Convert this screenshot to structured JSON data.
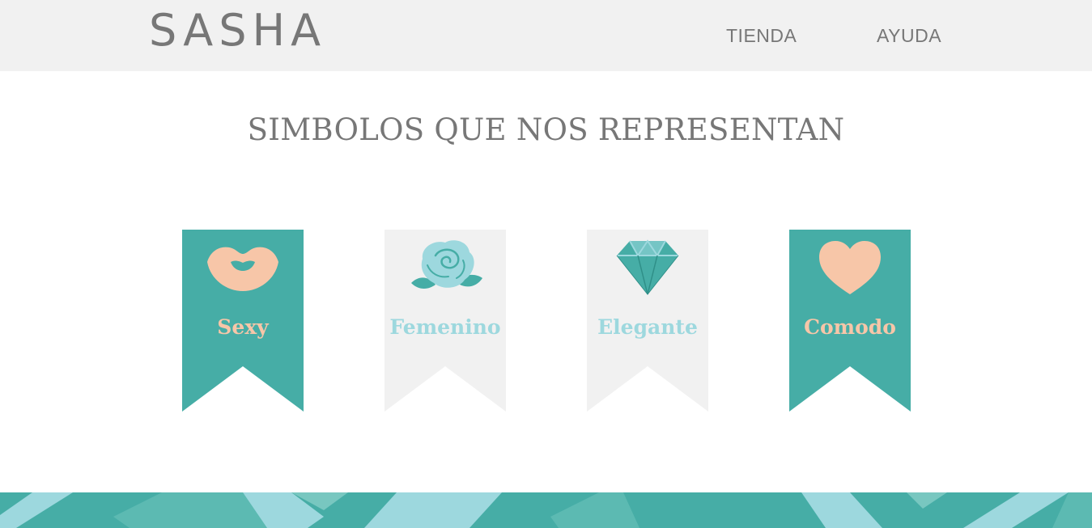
{
  "header": {
    "logo": "SASHA",
    "nav": [
      {
        "label": "TIENDA"
      },
      {
        "label": "AYUDA"
      }
    ]
  },
  "main": {
    "title": "SIMBOLOS QUE NOS REPRESENTAN",
    "symbols": [
      {
        "label": "Sexy",
        "icon": "lips-icon",
        "banner_color": "#46ada6",
        "text_color": "#f7c6a8"
      },
      {
        "label": "Femenino",
        "icon": "rose-icon",
        "banner_color": "#f1f1f1",
        "text_color": "#9dd8de"
      },
      {
        "label": "Elegante",
        "icon": "diamond-icon",
        "banner_color": "#f1f1f1",
        "text_color": "#9dd8de"
      },
      {
        "label": "Comodo",
        "icon": "heart-icon",
        "banner_color": "#46ada6",
        "text_color": "#f7c6a8"
      }
    ]
  },
  "colors": {
    "teal": "#46ada6",
    "light_teal": "#9dd8de",
    "peach": "#f7c6a8",
    "light_gray": "#f1f1f1",
    "text_gray": "#777777"
  }
}
